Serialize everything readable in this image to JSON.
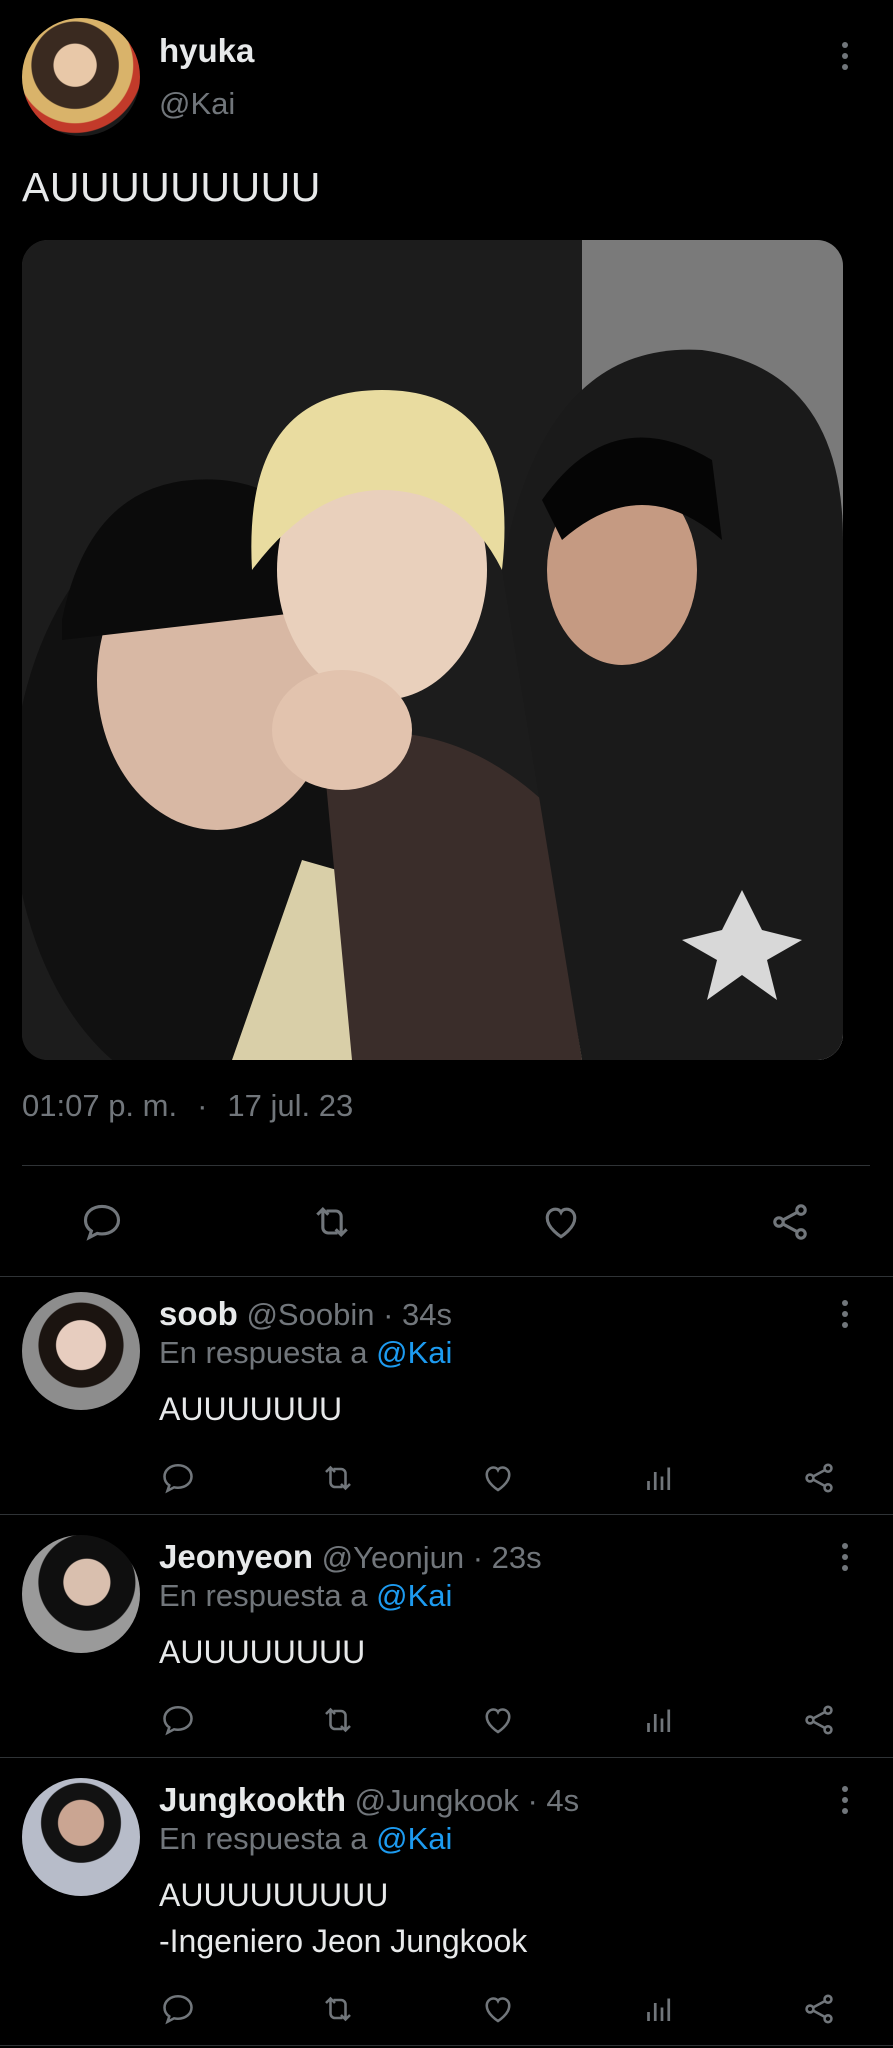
{
  "main_tweet": {
    "author_name": "hyuka",
    "author_handle": "@Kai",
    "text": "AUUUUUUUUU",
    "time": "01:07 p. m.",
    "separator": "·",
    "date": "17 jul. 23"
  },
  "replies": [
    {
      "name": "soob",
      "handle": "@Soobin",
      "time": "· 34s",
      "reply_prefix": "En respuesta a",
      "reply_to": "@Kai",
      "text_lines": [
        "AUUUUUUU"
      ]
    },
    {
      "name": "Jeonyeon",
      "handle": "@Yeonjun",
      "time": "· 23s",
      "reply_prefix": "En respuesta a",
      "reply_to": "@Kai",
      "text_lines": [
        "AUUUUUUUU"
      ]
    },
    {
      "name": "Jungkookth",
      "handle": "@Jungkook",
      "time": "· 4s",
      "reply_prefix": "En respuesta a",
      "reply_to": "@Kai",
      "text_lines": [
        "AUUUUUUUUU",
        "-Ingeniero Jeon Jungkook"
      ]
    }
  ],
  "icons": {
    "reply": "reply-icon",
    "retweet": "retweet-icon",
    "like": "like-icon",
    "analytics": "analytics-icon",
    "share": "share-icon",
    "more": "more-icon"
  },
  "colors": {
    "background": "#000000",
    "text": "#e7e9ea",
    "secondary": "#71767b",
    "link": "#1d9bf0",
    "divider": "#2f3336"
  }
}
